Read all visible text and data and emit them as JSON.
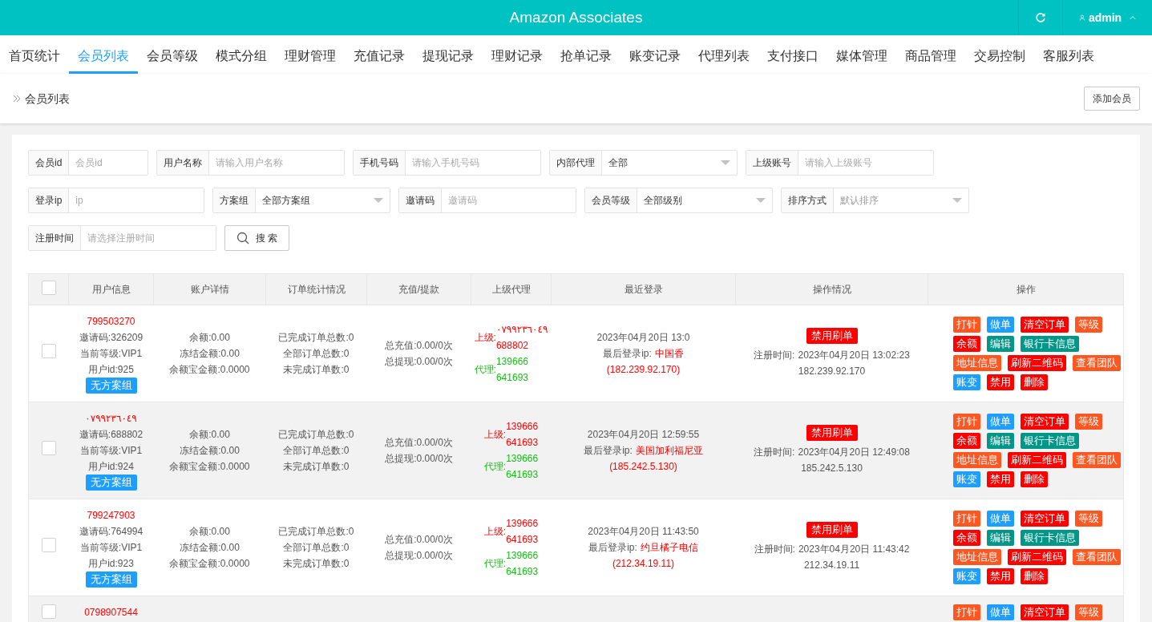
{
  "header": {
    "title": "Amazon Associates",
    "user": "admin"
  },
  "nav": [
    {
      "label": "首页统计",
      "selected": false
    },
    {
      "label": "会员列表",
      "selected": true
    },
    {
      "label": "会员等级",
      "selected": false
    },
    {
      "label": "模式分组",
      "selected": false
    },
    {
      "label": "理财管理",
      "selected": false
    },
    {
      "label": "充值记录",
      "selected": false
    },
    {
      "label": "提现记录",
      "selected": false
    },
    {
      "label": "理财记录",
      "selected": false
    },
    {
      "label": "抢单记录",
      "selected": false
    },
    {
      "label": "账变记录",
      "selected": false
    },
    {
      "label": "代理列表",
      "selected": false
    },
    {
      "label": "支付接口",
      "selected": false
    },
    {
      "label": "媒体管理",
      "selected": false
    },
    {
      "label": "商品管理",
      "selected": false
    },
    {
      "label": "交易控制",
      "selected": false
    },
    {
      "label": "客服列表",
      "selected": false
    }
  ],
  "breadcrumb": "会员列表",
  "add_button": "添加会员",
  "filters": [
    [
      {
        "kind": "input",
        "label": "会员id",
        "placeholder": "会员id"
      },
      {
        "kind": "input",
        "label": "用户名称",
        "placeholder": "请输入用户名称"
      },
      {
        "kind": "input",
        "label": "手机号码",
        "placeholder": "请输入手机号码"
      },
      {
        "kind": "select",
        "label": "内部代理",
        "value": "全部"
      },
      {
        "kind": "input",
        "label": "上级账号",
        "placeholder": "请输入上级账号"
      }
    ],
    [
      {
        "kind": "input",
        "label": "登录ip",
        "placeholder": "ip"
      },
      {
        "kind": "select",
        "label": "方案组",
        "value": "全部方案组"
      },
      {
        "kind": "input",
        "label": "邀请码",
        "placeholder": "邀请码"
      },
      {
        "kind": "select",
        "label": "会员等级",
        "value": "全部级别"
      },
      {
        "kind": "select",
        "label": "排序方式",
        "placeholder": "默认排序"
      }
    ],
    [
      {
        "kind": "input",
        "label": "注册时间",
        "placeholder": "请选择注册时间"
      },
      {
        "kind": "button",
        "label": "搜 索"
      }
    ]
  ],
  "select_all_checked": false,
  "table": {
    "columns": [
      "用户信息",
      "账户详情",
      "订单统计情况",
      "充值/提款",
      "上级代理",
      "最近登录",
      "操作情况",
      "操作"
    ],
    "rows": [
      {
        "checked": false,
        "phone": "799503270",
        "info": [
          "邀请码:326209",
          "当前等级:VIP1",
          "用户id:925"
        ],
        "tag": "无方案组",
        "account": [
          "余额:0.00",
          "冻结金额:0.00",
          "余额宝金额:0.0000"
        ],
        "orders": [
          "已完成订单总数:0",
          "全部订单总数:0",
          "未完成订单数:0"
        ],
        "money": [
          "总充值:0.00/0次",
          "总提现:0.00/0次"
        ],
        "upline": {
          "label": "上级:",
          "values": [
            "٠٧٩٩٢٣٦٠٤٩",
            "688802"
          ]
        },
        "agent": {
          "label": "代理:",
          "values": [
            "139666",
            "641693"
          ]
        },
        "login_time": "2023年04月20日 13:0",
        "login_ip_label": "最后登录ip:",
        "login_place": "中国香",
        "login_ip": "(182.239.92.170)",
        "status": "禁用刷单",
        "reg_label": "注册时间:",
        "reg_time": "2023年04月20日 13:02:23",
        "reg_ip": "182.239.92.170",
        "actions": [
          {
            "label": "打针",
            "color": "#ff5722"
          },
          {
            "label": "做单",
            "color": "#1e9fff"
          },
          {
            "label": "清空订单",
            "color": "#ff0000"
          },
          {
            "label": "等级",
            "color": "#ff5722"
          },
          {
            "label": "余额",
            "color": "#ff0000"
          },
          {
            "label": "编辑",
            "color": "#009688"
          },
          {
            "label": "银行卡信息",
            "color": "#009688"
          },
          {
            "label": "地址信息",
            "color": "#ff5722"
          },
          {
            "label": "刷新二维码",
            "color": "#ff0000"
          },
          {
            "label": "查看团队",
            "color": "#ff5722"
          },
          {
            "label": "账变",
            "color": "#1e9fff"
          },
          {
            "label": "禁用",
            "color": "#ff0000"
          },
          {
            "label": "删除",
            "color": "#ff0000"
          }
        ]
      },
      {
        "checked": false,
        "phone": "٠٧٩٩٢٣٦٠٤٩",
        "info": [
          "邀请码:688802",
          "当前等级:VIP1",
          "用户id:924"
        ],
        "tag": "无方案组",
        "account": [
          "余额:0.00",
          "冻结金额:0.00",
          "余额宝金额:0.0000"
        ],
        "orders": [
          "已完成订单总数:0",
          "全部订单总数:0",
          "未完成订单数:0"
        ],
        "money": [
          "总充值:0.00/0次",
          "总提现:0.00/0次"
        ],
        "upline": {
          "label": "上级:",
          "values": [
            "139666",
            "641693"
          ]
        },
        "agent": {
          "label": "代理:",
          "values": [
            "139666",
            "641693"
          ]
        },
        "login_time": "2023年04月20日 12:59:55",
        "login_ip_label": "最后登录ip:",
        "login_place": "美国加利福尼亚",
        "login_ip": "(185.242.5.130)",
        "status": "禁用刷单",
        "reg_label": "注册时间:",
        "reg_time": "2023年04月20日 12:49:08",
        "reg_ip": "185.242.5.130",
        "actions": [
          {
            "label": "打针",
            "color": "#ff5722"
          },
          {
            "label": "做单",
            "color": "#1e9fff"
          },
          {
            "label": "清空订单",
            "color": "#ff0000"
          },
          {
            "label": "等级",
            "color": "#ff5722"
          },
          {
            "label": "余额",
            "color": "#ff0000"
          },
          {
            "label": "编辑",
            "color": "#009688"
          },
          {
            "label": "银行卡信息",
            "color": "#009688"
          },
          {
            "label": "地址信息",
            "color": "#ff5722"
          },
          {
            "label": "刷新二维码",
            "color": "#ff0000"
          },
          {
            "label": "查看团队",
            "color": "#ff5722"
          },
          {
            "label": "账变",
            "color": "#1e9fff"
          },
          {
            "label": "禁用",
            "color": "#ff0000"
          },
          {
            "label": "删除",
            "color": "#ff0000"
          }
        ]
      },
      {
        "checked": false,
        "phone": "799247903",
        "info": [
          "邀请码:764994",
          "当前等级:VIP1",
          "用户id:923"
        ],
        "tag": "无方案组",
        "account": [
          "余额:0.00",
          "冻结金额:0.00",
          "余额宝金额:0.0000"
        ],
        "orders": [
          "已完成订单总数:0",
          "全部订单总数:0",
          "未完成订单数:0"
        ],
        "money": [
          "总充值:0.00/0次",
          "总提现:0.00/0次"
        ],
        "upline": {
          "label": "上级:",
          "values": [
            "139666",
            "641693"
          ]
        },
        "agent": {
          "label": "代理:",
          "values": [
            "139666",
            "641693"
          ]
        },
        "login_time": "2023年04月20日 11:43:50",
        "login_ip_label": "最后登录ip:",
        "login_place": "约旦橘子电信",
        "login_ip": "(212.34.19.11)",
        "status": "禁用刷单",
        "reg_label": "注册时间:",
        "reg_time": "2023年04月20日 11:43:42",
        "reg_ip": "212.34.19.11",
        "actions": [
          {
            "label": "打针",
            "color": "#ff5722"
          },
          {
            "label": "做单",
            "color": "#1e9fff"
          },
          {
            "label": "清空订单",
            "color": "#ff0000"
          },
          {
            "label": "等级",
            "color": "#ff5722"
          },
          {
            "label": "余额",
            "color": "#ff0000"
          },
          {
            "label": "编辑",
            "color": "#009688"
          },
          {
            "label": "银行卡信息",
            "color": "#009688"
          },
          {
            "label": "地址信息",
            "color": "#ff5722"
          },
          {
            "label": "刷新二维码",
            "color": "#ff0000"
          },
          {
            "label": "查看团队",
            "color": "#ff5722"
          },
          {
            "label": "账变",
            "color": "#1e9fff"
          },
          {
            "label": "禁用",
            "color": "#ff0000"
          },
          {
            "label": "删除",
            "color": "#ff0000"
          }
        ]
      },
      {
        "checked": false,
        "phone": "0798907544",
        "actions": [
          {
            "label": "打针",
            "color": "#ff5722"
          },
          {
            "label": "做单",
            "color": "#1e9fff"
          },
          {
            "label": "清空订单",
            "color": "#ff0000"
          },
          {
            "label": "等级",
            "color": "#ff5722"
          }
        ]
      }
    ]
  }
}
